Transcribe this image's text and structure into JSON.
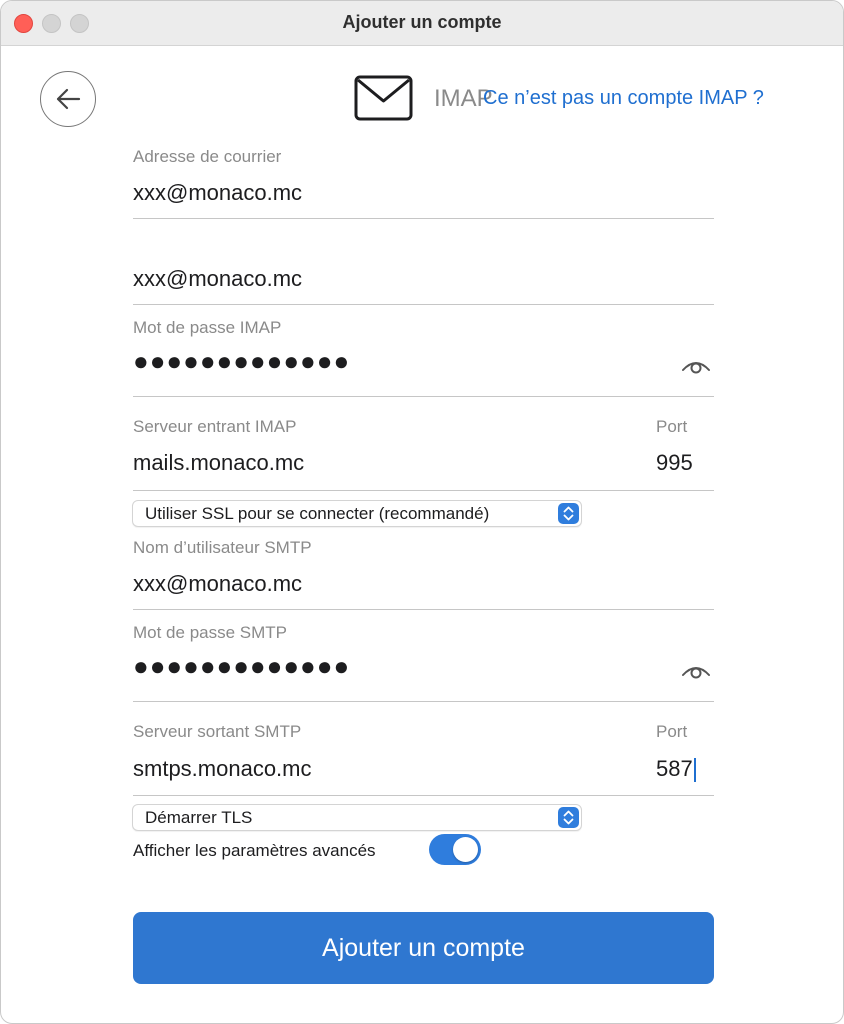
{
  "window": {
    "title": "Ajouter un compte"
  },
  "header": {
    "protocol": "IMAP",
    "not_imap_link": "Ce n’est pas un compte IMAP ?"
  },
  "fields": {
    "email_label": "Adresse de courrier",
    "email_value": "xxx@monaco.mc",
    "username_value": "xxx@monaco.mc",
    "imap_password_label": "Mot de passe IMAP",
    "imap_password_masked": "●●●●●●●●●●●●●",
    "incoming_server_label": "Serveur entrant IMAP",
    "incoming_server_value": "mails.monaco.mc",
    "incoming_port_label": "Port",
    "incoming_port_value": "995",
    "incoming_security_selected": "Utiliser SSL pour se connecter (recommandé)",
    "smtp_username_label": "Nom d’utilisateur SMTP",
    "smtp_username_value": "xxx@monaco.mc",
    "smtp_password_label": "Mot de passe SMTP",
    "smtp_password_masked": "●●●●●●●●●●●●●",
    "outgoing_server_label": "Serveur sortant SMTP",
    "outgoing_server_value": "smtps.monaco.mc",
    "outgoing_port_label": "Port",
    "outgoing_port_value": "587",
    "outgoing_security_selected": "Démarrer TLS"
  },
  "advanced": {
    "label": "Afficher les paramètres avancés",
    "enabled": true
  },
  "actions": {
    "add_account": "Ajouter un compte"
  },
  "colors": {
    "accent": "#2f77d0",
    "link": "#1f6fd0",
    "close": "#ff5f57"
  },
  "icons": {
    "back": "arrow-left-icon",
    "mail": "envelope-icon",
    "reveal": "eye-icon",
    "stepper": "chevron-updown-icon"
  }
}
